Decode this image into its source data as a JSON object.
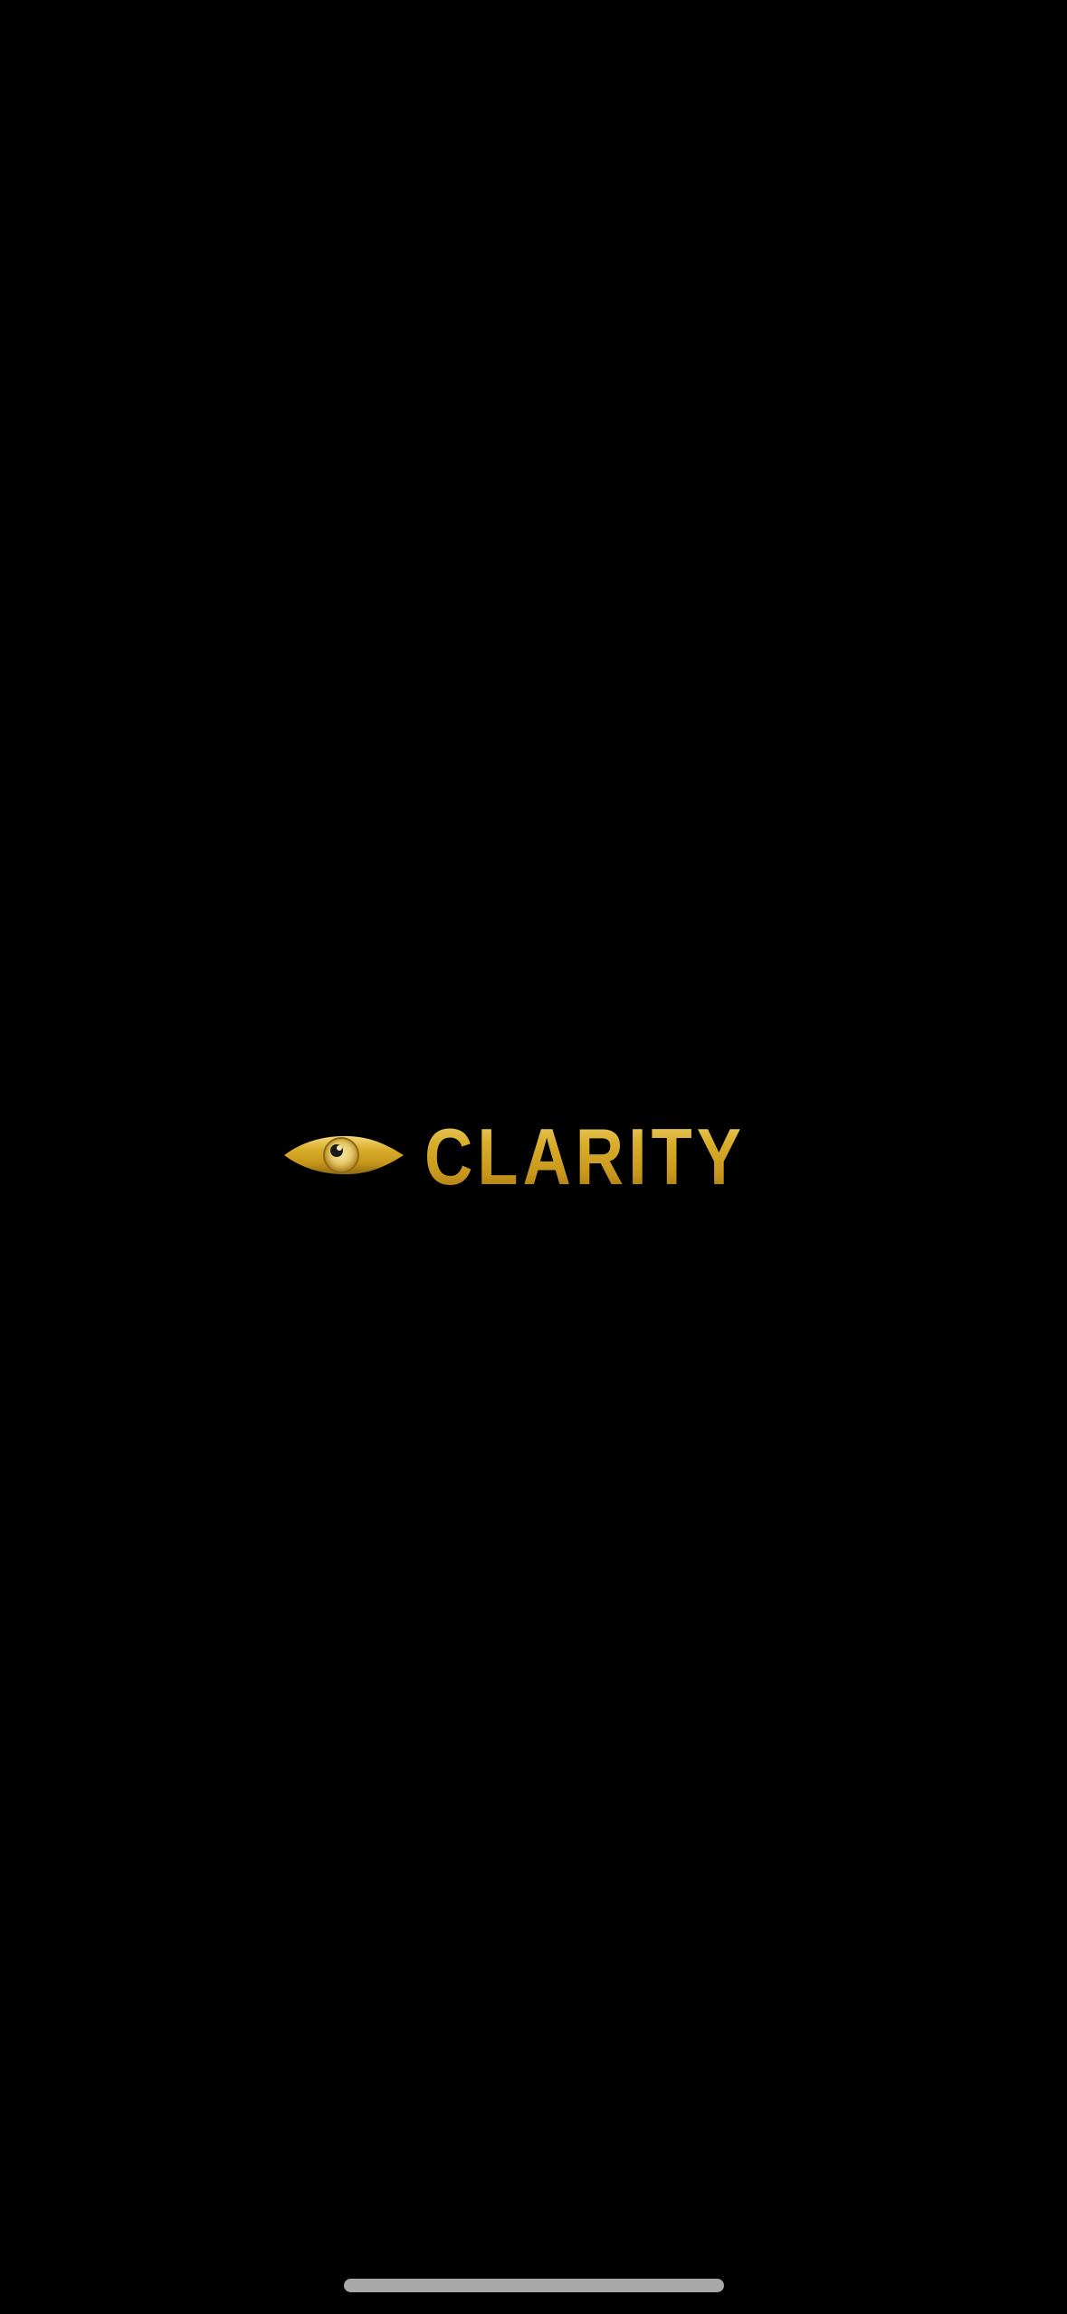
{
  "app": {
    "brand_name": "CLARITY",
    "logo_icon": "eye-icon",
    "background_color": "#000000",
    "logo_gold_light": "#F4D77A",
    "logo_gold": "#D8AE2A",
    "logo_gold_dark": "#8E6A12"
  },
  "system": {
    "home_indicator_icon": "home-indicator"
  }
}
